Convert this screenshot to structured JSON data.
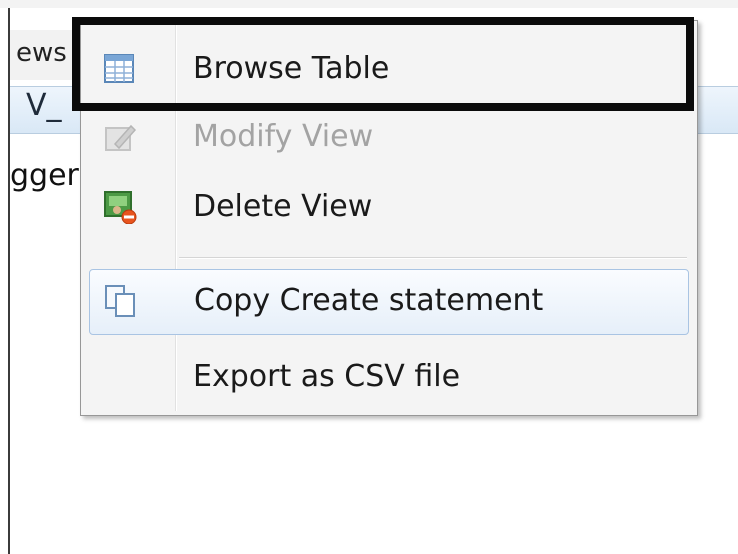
{
  "background": {
    "top_strip_text": "",
    "tab_label": "ews",
    "header_label": "V_",
    "row_label": "gger"
  },
  "context_menu": {
    "items": [
      {
        "label": "Browse Table",
        "icon": "table-grid-icon",
        "enabled": true
      },
      {
        "label": "Modify View",
        "icon": "edit-view-icon",
        "enabled": false
      },
      {
        "label": "Delete View",
        "icon": "delete-view-icon",
        "enabled": true
      },
      {
        "label": "Copy Create statement",
        "icon": "copy-icon",
        "enabled": true,
        "hovered": true
      },
      {
        "label": "Export as CSV file",
        "icon": "",
        "enabled": true
      }
    ]
  },
  "colors": {
    "menu_background": "#f4f4f4",
    "hover_border": "#a9c4e3",
    "disabled_text": "#a3a3a3",
    "highlight_box": "#0b0b0b"
  }
}
